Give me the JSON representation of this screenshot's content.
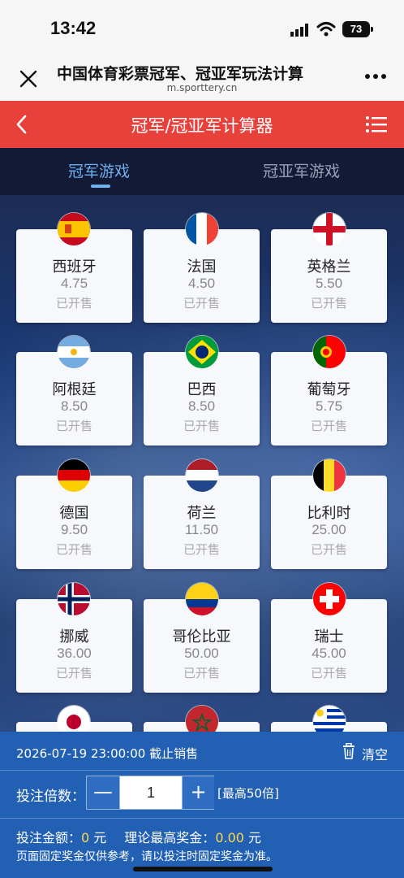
{
  "status_bar": {
    "time": "13:42",
    "battery": "73"
  },
  "browser": {
    "title": "中国体育彩票冠军、冠亚军玩法计算",
    "url": "m.sporttery.cn"
  },
  "header": {
    "title": "冠军/冠亚军计算器"
  },
  "tabs": [
    {
      "label": "冠军游戏",
      "active": true
    },
    {
      "label": "冠亚军游戏",
      "active": false
    }
  ],
  "teams": [
    {
      "name": "西班牙",
      "odds": "4.75",
      "status": "已开售",
      "flag": "spain-flag-icon"
    },
    {
      "name": "法国",
      "odds": "4.50",
      "status": "已开售",
      "flag": "france-flag-icon"
    },
    {
      "name": "英格兰",
      "odds": "5.50",
      "status": "已开售",
      "flag": "england-flag-icon"
    },
    {
      "name": "阿根廷",
      "odds": "8.50",
      "status": "已开售",
      "flag": "argentina-flag-icon"
    },
    {
      "name": "巴西",
      "odds": "8.50",
      "status": "已开售",
      "flag": "brazil-flag-icon"
    },
    {
      "name": "葡萄牙",
      "odds": "5.75",
      "status": "已开售",
      "flag": "portugal-flag-icon"
    },
    {
      "name": "德国",
      "odds": "9.50",
      "status": "已开售",
      "flag": "germany-flag-icon"
    },
    {
      "name": "荷兰",
      "odds": "11.50",
      "status": "已开售",
      "flag": "netherlands-flag-icon"
    },
    {
      "name": "比利时",
      "odds": "25.00",
      "status": "已开售",
      "flag": "belgium-flag-icon"
    },
    {
      "name": "挪威",
      "odds": "36.00",
      "status": "已开售",
      "flag": "norway-flag-icon"
    },
    {
      "name": "哥伦比亚",
      "odds": "50.00",
      "status": "已开售",
      "flag": "colombia-flag-icon"
    },
    {
      "name": "瑞士",
      "odds": "45.00",
      "status": "已开售",
      "flag": "switzerland-flag-icon"
    },
    {
      "name": "",
      "odds": "",
      "status": "",
      "flag": "japan-flag-icon"
    },
    {
      "name": "",
      "odds": "",
      "status": "",
      "flag": "morocco-flag-icon"
    },
    {
      "name": "",
      "odds": "",
      "status": "",
      "flag": "uruguay-flag-icon"
    }
  ],
  "bottom": {
    "deadline": "2026-07-19 23:00:00 截止销售",
    "clear_label": "清空",
    "multiplier_label": "投注倍数：",
    "minus": "—",
    "multiplier_value": "1",
    "plus": "+",
    "multiplier_max": "[最高50倍]",
    "amount_label": "投注金额：",
    "amount_value": "0",
    "amount_unit": " 元",
    "prize_label": "理论最高奖金：",
    "prize_value": "0.00",
    "prize_unit": " 元",
    "note": "页面固定奖金仅供参考，请以投注时固定奖金为准。"
  },
  "colors": {
    "header_red": "#e8413c",
    "tab_bar": "#131a36",
    "active_tab": "#6fb0ef",
    "bottom_panel": "#2260b4",
    "highlight_value": "#ffd84a"
  }
}
